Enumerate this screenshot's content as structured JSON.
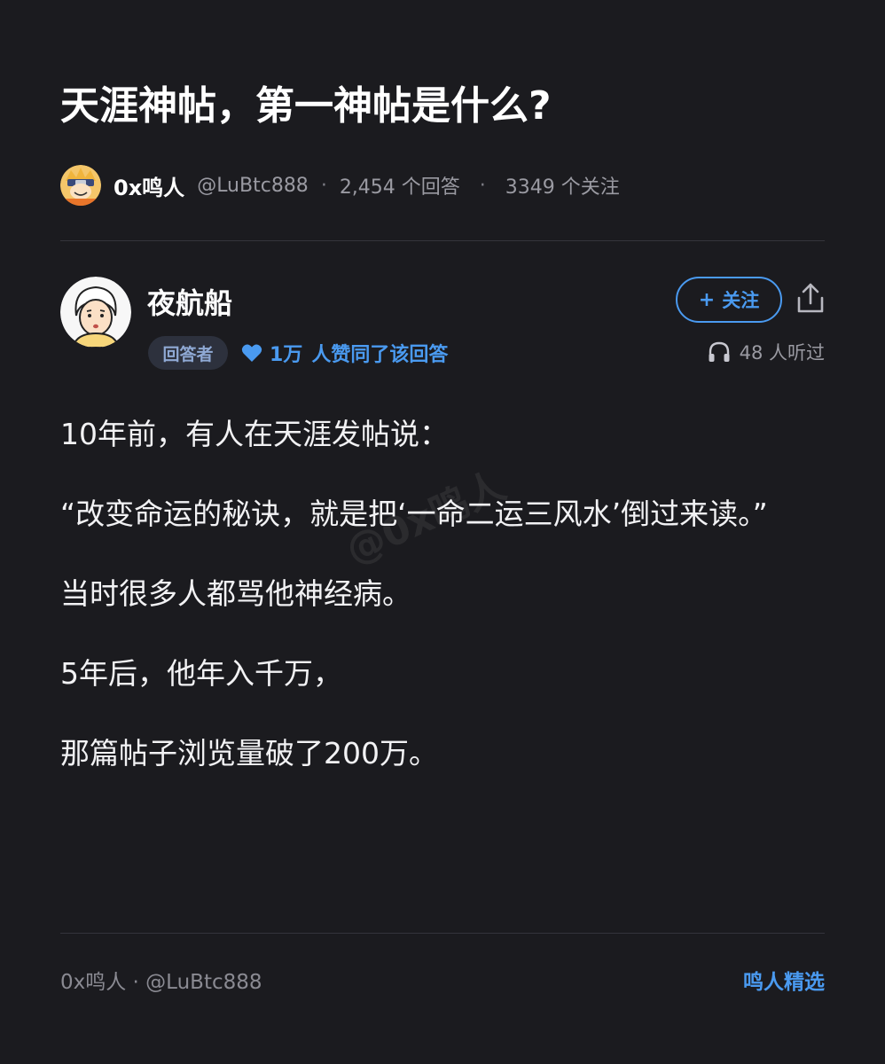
{
  "question": {
    "title": "天涯神帖，第一神帖是什么?"
  },
  "author": {
    "name": "0x鸣人",
    "handle": "@LuBtc888",
    "answers": "2,454 个回答",
    "followers": "3349 个关注",
    "separator": "·"
  },
  "answer": {
    "name": "夜航船",
    "role_badge": "回答者",
    "likes_count": "1万",
    "likes_text": "人赞同了该回答",
    "follow_label": "关注",
    "follow_plus": "+",
    "listeners": "48 人听过",
    "paragraphs": [
      "10年前，有人在天涯发帖说：",
      "“改变命运的秘诀，就是把‘一命二运三风水’倒过来读。”",
      "当时很多人都骂他神经病。",
      "5年后，他年入千万，",
      "那篇帖子浏览量破了200万。"
    ]
  },
  "watermark": "@0x鸣人",
  "footer": {
    "left": "0x鸣人 · @LuBtc888",
    "right": "鸣人精选"
  },
  "colors": {
    "background": "#1b1b1f",
    "accent": "#4a9af0",
    "muted": "#9a9aa2",
    "divider": "#34343b"
  }
}
